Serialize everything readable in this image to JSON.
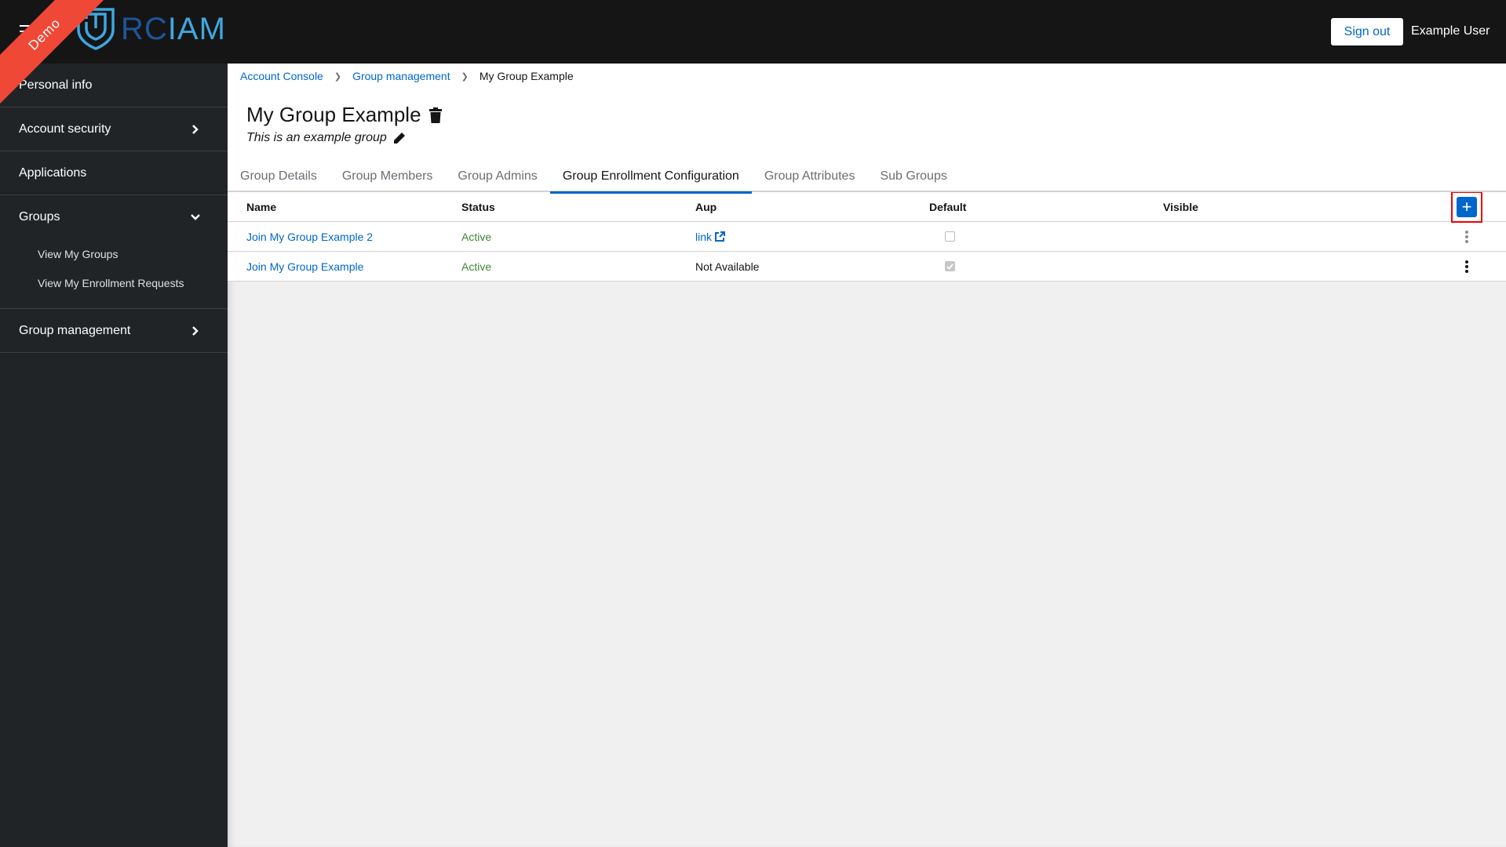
{
  "header": {
    "ribbon": "Demo",
    "logo": {
      "part1": "RC",
      "part2": "IAM",
      "color1": "#1f5499",
      "color2": "#3ea7e0"
    },
    "signout_label": "Sign out",
    "username": "Example User"
  },
  "sidebar": {
    "items": [
      {
        "label": "Personal info"
      },
      {
        "label": "Account security",
        "icon": "chevron-right-icon"
      },
      {
        "label": "Applications"
      },
      {
        "label": "Groups",
        "icon": "chevron-down-icon",
        "children": [
          {
            "label": "View My Groups"
          },
          {
            "label": "View My Enrollment Requests"
          }
        ]
      },
      {
        "label": "Group management",
        "icon": "chevron-right-icon"
      }
    ]
  },
  "breadcrumb": [
    {
      "label": "Account Console"
    },
    {
      "label": "Group management"
    },
    {
      "label": "My Group Example"
    }
  ],
  "page": {
    "title": "My Group Example",
    "description": "This is an example group"
  },
  "tabs": [
    {
      "label": "Group Details"
    },
    {
      "label": "Group Members"
    },
    {
      "label": "Group Admins"
    },
    {
      "label": "Group Enrollment Configuration",
      "active": true
    },
    {
      "label": "Group Attributes"
    },
    {
      "label": "Sub Groups"
    }
  ],
  "table": {
    "columns": [
      "Name",
      "Status",
      "Aup",
      "Default",
      "Visible"
    ],
    "add_label": "+",
    "rows": [
      {
        "name": "Join My Group Example 2",
        "status": "Active",
        "aup": "link",
        "aup_is_link": true,
        "default": false,
        "visible": ""
      },
      {
        "name": "Join My Group Example",
        "status": "Active",
        "aup": "Not Available",
        "aup_is_link": false,
        "default": true,
        "visible": ""
      }
    ]
  },
  "colors": {
    "accent": "#0066cc",
    "active_status": "#3e8635",
    "ribbon": "#ef4836",
    "highlight_box": "#ee0000"
  }
}
